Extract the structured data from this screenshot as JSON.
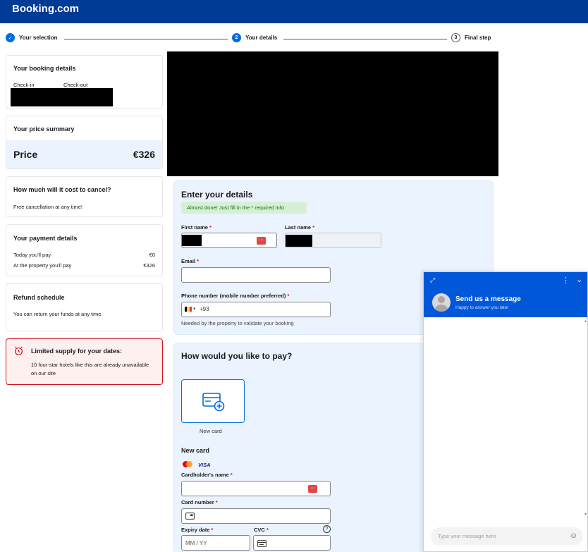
{
  "brand": {
    "name": "Booking.com",
    "color": "#003b95",
    "accent": "#006ce4"
  },
  "stepper": {
    "steps": [
      {
        "label": "Your selection",
        "marker": "✓"
      },
      {
        "label": "Your details",
        "marker": "2"
      },
      {
        "label": "Final step",
        "marker": "3"
      }
    ]
  },
  "booking_details": {
    "title": "Your booking details",
    "checkin_label": "Check-in",
    "checkout_label": "Check-out"
  },
  "price_summary": {
    "title": "Your price summary",
    "price_label": "Price",
    "price_value": "€326"
  },
  "cancel": {
    "title": "How much will it cost to cancel?",
    "text": "Free cancellation at any time!"
  },
  "payment_details": {
    "title": "Your payment details",
    "rows": [
      {
        "label": "Today you'll pay",
        "value": "€0"
      },
      {
        "label": "At the property you'll pay",
        "value": "€326"
      }
    ]
  },
  "refund": {
    "title": "Refund schedule",
    "text": "You can return your funds at any time."
  },
  "limited": {
    "title": "Limited supply for your dates:",
    "text": "10 four-star hotels like this are already unavailable on our site"
  },
  "details_form": {
    "title": "Enter your details",
    "notice": "Almost done! Just fill in the * required info",
    "first_name_label": "First name",
    "last_name_label": "Last name",
    "email_label": "Email",
    "phone_label": "Phone number (mobile number preferred)",
    "phone_value": "+93",
    "phone_hint": "Needed by the property to validate your booking"
  },
  "payment_form": {
    "title": "How would you like to pay?",
    "new_card_option": "New card",
    "section_title": "New card",
    "card_brand": "VISA",
    "cardholder_label": "Cardholder's name",
    "card_number_label": "Card number",
    "expiry_label": "Expiry date",
    "expiry_placeholder": "MM / YY",
    "cvc_label": "CVC",
    "help_icon": "?"
  },
  "chat": {
    "title": "Send us a message",
    "subtitle": "Happy to answer you later",
    "input_placeholder": "Type your message here"
  },
  "required_mark": "*"
}
